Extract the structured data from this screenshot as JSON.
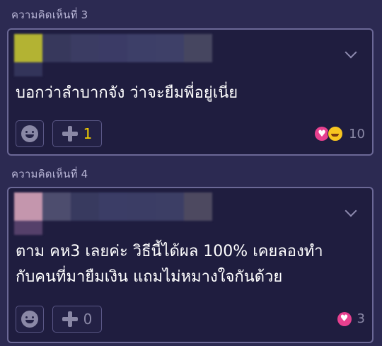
{
  "comments": [
    {
      "header": "ความคิดเห็นที่ 3",
      "text": "บอกว่าลำบากจัง ว่าจะยืมพี่อยู่เนี่ย",
      "plus_count": "1",
      "reaction_count": "10",
      "reactions": [
        "heart-icon",
        "laugh-icon"
      ],
      "avatar_colors": [
        "#b3b333",
        "#37385c",
        "#3b3c63",
        "#3b3b66",
        "#3d3f68",
        "#3e4068",
        "#464660"
      ]
    },
    {
      "header": "ความคิดเห็นที่ 4",
      "text_lines": [
        "ตาม คห3 เลยค่ะ วิธีนี้ได้ผล 100% เคยลองทำ",
        "กับคนที่มายืมเงิน แถมไม่หมางใจกันด้วย"
      ],
      "plus_count": "0",
      "reaction_count": "3",
      "reactions": [
        "heart-icon"
      ],
      "avatar_colors": [
        "#c496ad",
        "#4d4d6e",
        "#383a5f",
        "#3b3d66",
        "#3b3d65",
        "#3c3e65",
        "#4d4960"
      ]
    }
  ],
  "colors": {
    "background": "#2c2a52",
    "card": "#1f1d3f",
    "border": "#6b6896",
    "accent_yellow": "#f5d000",
    "heart": "#e7408f"
  }
}
